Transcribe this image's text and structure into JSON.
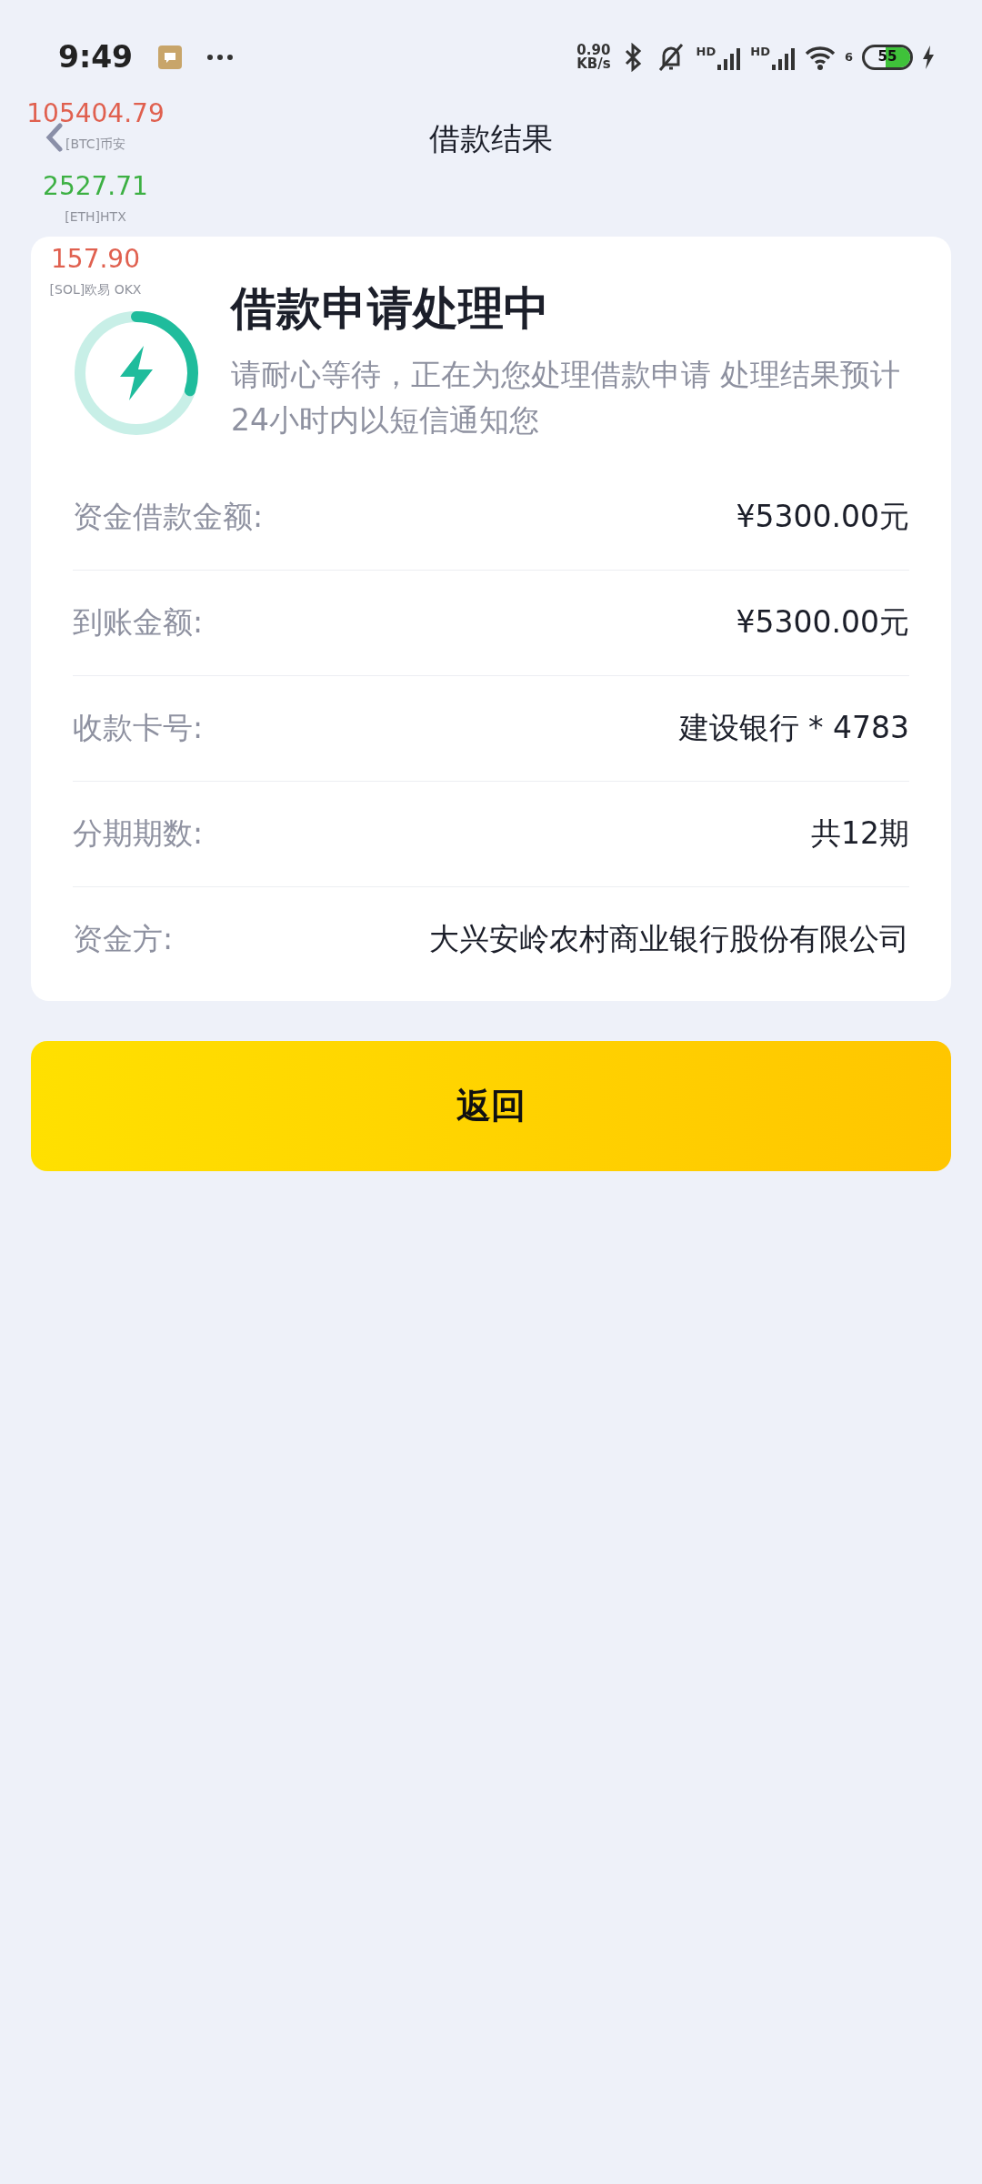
{
  "status_bar": {
    "time": "9:49",
    "net_speed": {
      "value": "0.90",
      "unit": "KB/s"
    },
    "signal_labels": [
      "HD",
      "HD"
    ],
    "wifi_label": "6",
    "battery": "55"
  },
  "ticker": [
    {
      "price": "105404.79",
      "color": "#e0604f",
      "source": "[BTC]币安"
    },
    {
      "price": "2527.71",
      "color": "#3cb043",
      "source": "[ETH]HTX"
    },
    {
      "price": "157.90",
      "color": "#e0604f",
      "source": "[SOL]欧易 OKX"
    }
  ],
  "header": {
    "title": "借款结果"
  },
  "status": {
    "title": "借款申请处理中",
    "message": "请耐心等待，正在为您处理借款申请 处理结果预计24小时内以短信通知您",
    "level": 0.3
  },
  "details": [
    {
      "label": "资金借款金额:",
      "value": "¥5300.00元"
    },
    {
      "label": "到账金额:",
      "value": "¥5300.00元"
    },
    {
      "label": "收款卡号:",
      "value": "建设银行 * 4783"
    },
    {
      "label": "分期期数:",
      "value": "共12期"
    },
    {
      "label": "资金方:",
      "value": "大兴安岭农村商业银行股份有限公司"
    }
  ],
  "button": {
    "label": "返回"
  }
}
